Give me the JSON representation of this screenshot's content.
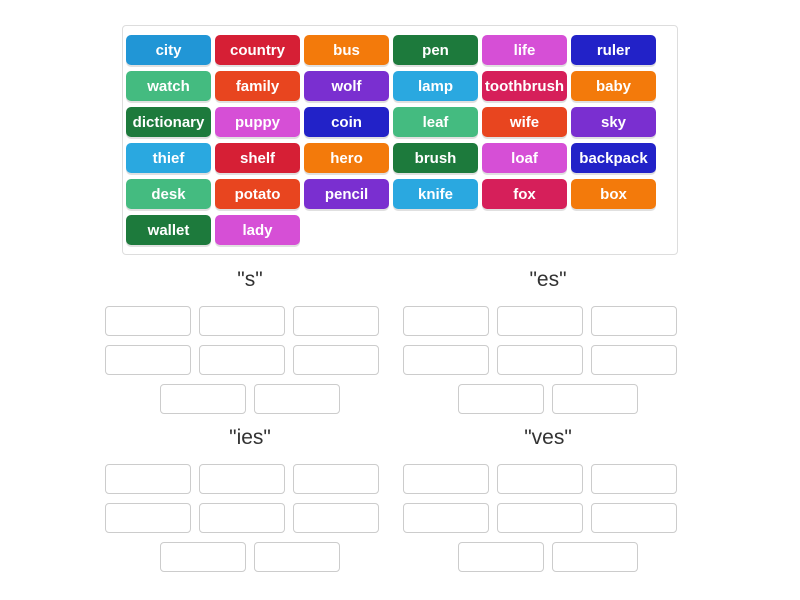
{
  "word_bank": {
    "name": "word-bank",
    "rows": [
      [
        {
          "label": "city",
          "color": "#2196d6"
        },
        {
          "label": "country",
          "color": "#d61f35"
        },
        {
          "label": "bus",
          "color": "#f37a0b"
        },
        {
          "label": "pen",
          "color": "#1d7a3c"
        },
        {
          "label": "life",
          "color": "#d64fd6"
        },
        {
          "label": "ruler",
          "color": "#2222c8"
        }
      ],
      [
        {
          "label": "watch",
          "color": "#44bb80"
        },
        {
          "label": "family",
          "color": "#e8451f"
        },
        {
          "label": "wolf",
          "color": "#7a2fd0"
        },
        {
          "label": "lamp",
          "color": "#2aa8e0"
        },
        {
          "label": "toothbrush",
          "color": "#d61f5a"
        },
        {
          "label": "baby",
          "color": "#f37a0b"
        }
      ],
      [
        {
          "label": "dictionary",
          "color": "#1d7a3c"
        },
        {
          "label": "puppy",
          "color": "#d64fd6"
        },
        {
          "label": "coin",
          "color": "#2222c8"
        },
        {
          "label": "leaf",
          "color": "#44bb80"
        },
        {
          "label": "wife",
          "color": "#e8451f"
        },
        {
          "label": "sky",
          "color": "#7a2fd0"
        }
      ],
      [
        {
          "label": "thief",
          "color": "#2aa8e0"
        },
        {
          "label": "shelf",
          "color": "#d61f35"
        },
        {
          "label": "hero",
          "color": "#f37a0b"
        },
        {
          "label": "brush",
          "color": "#1d7a3c"
        },
        {
          "label": "loaf",
          "color": "#d64fd6"
        },
        {
          "label": "backpack",
          "color": "#2222c8"
        }
      ],
      [
        {
          "label": "desk",
          "color": "#44bb80"
        },
        {
          "label": "potato",
          "color": "#e8451f"
        },
        {
          "label": "pencil",
          "color": "#7a2fd0"
        },
        {
          "label": "knife",
          "color": "#2aa8e0"
        },
        {
          "label": "fox",
          "color": "#d61f5a"
        },
        {
          "label": "box",
          "color": "#f37a0b"
        }
      ],
      [
        {
          "label": "wallet",
          "color": "#1d7a3c"
        },
        {
          "label": "lady",
          "color": "#d64fd6"
        }
      ]
    ]
  },
  "groups": [
    {
      "id": "s",
      "title": "\"s\"",
      "slot_rows": [
        3,
        3,
        2
      ],
      "slots": [
        "",
        "",
        "",
        "",
        "",
        "",
        "",
        ""
      ]
    },
    {
      "id": "es",
      "title": "\"es\"",
      "slot_rows": [
        3,
        3,
        2
      ],
      "slots": [
        "",
        "",
        "",
        "",
        "",
        "",
        "",
        ""
      ]
    },
    {
      "id": "ies",
      "title": "\"ies\"",
      "slot_rows": [
        3,
        3,
        2
      ],
      "slots": [
        "",
        "",
        "",
        "",
        "",
        "",
        "",
        ""
      ]
    },
    {
      "id": "ves",
      "title": "\"ves\"",
      "slot_rows": [
        3,
        3,
        2
      ],
      "slots": [
        "",
        "",
        "",
        "",
        "",
        "",
        "",
        ""
      ]
    }
  ]
}
